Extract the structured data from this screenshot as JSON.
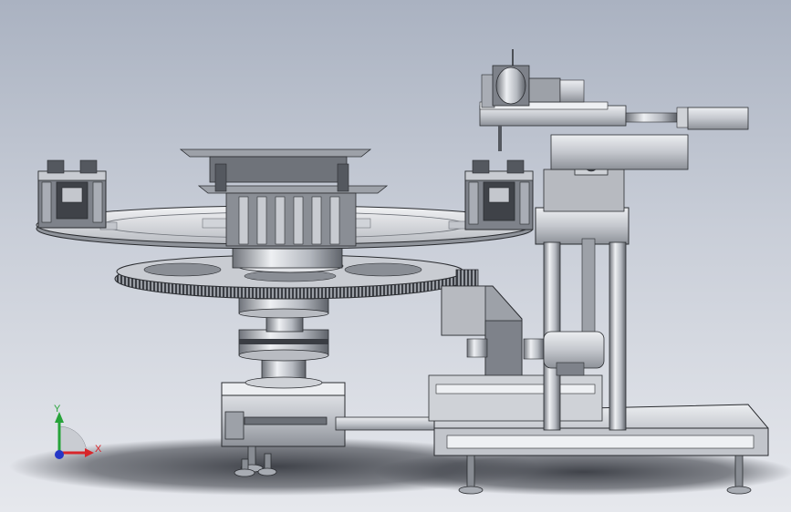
{
  "triad": {
    "x_label": "X",
    "y_label": "Y"
  },
  "colors": {
    "background_top": "#aab2c1",
    "background_bottom": "#e6e8ed",
    "metal_light": "#d9dbe0",
    "metal_mid": "#a9adb5",
    "metal_dark": "#54585f",
    "outline": "#2a2c30",
    "shadow": "#3c3f46",
    "axis_x": "#d8252a",
    "axis_y": "#27a33a",
    "axis_z": "#2536c7"
  }
}
